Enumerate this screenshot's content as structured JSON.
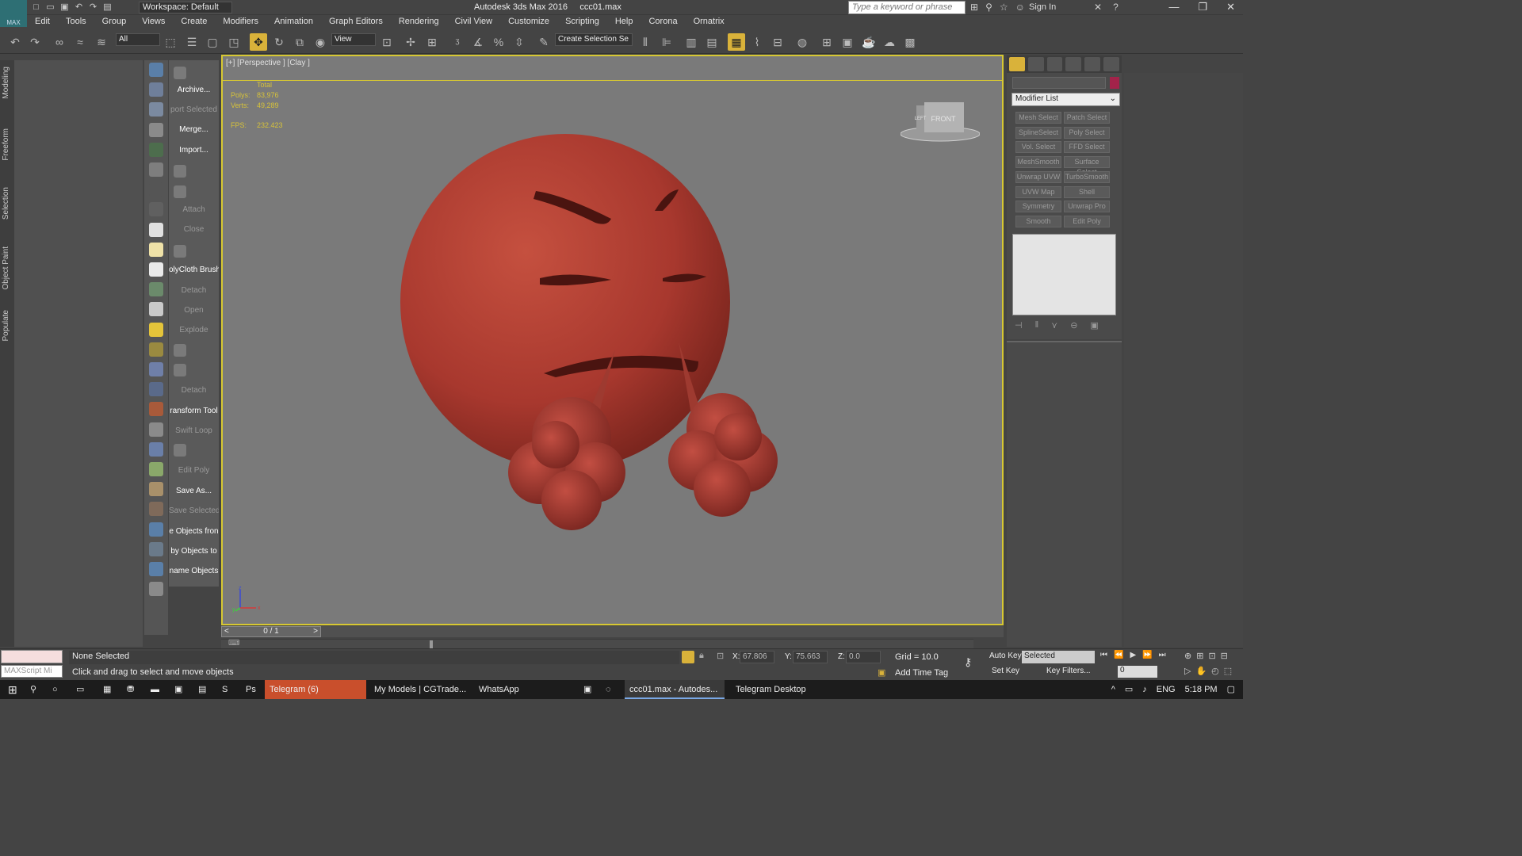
{
  "app": {
    "logo_text": "MAX",
    "title": "Autodesk 3ds Max 2016",
    "file": "ccc01.max",
    "workspace": "Workspace: Default",
    "search_placeholder": "Type a keyword or phrase",
    "sign_in": "Sign In"
  },
  "menu": [
    "Edit",
    "Tools",
    "Group",
    "Views",
    "Create",
    "Modifiers",
    "Animation",
    "Graph Editors",
    "Rendering",
    "Civil View",
    "Customize",
    "Scripting",
    "Help",
    "Corona",
    "Ornatrix"
  ],
  "toolbar": {
    "filter": "All",
    "refcoord": "View",
    "selection_set": "Create Selection Se"
  },
  "ribbon_tabs": [
    "Modeling",
    "Freeform",
    "Selection",
    "Object Paint",
    "Populate"
  ],
  "commands": [
    {
      "label": "Archive...",
      "enabled": true
    },
    {
      "label": "port Selected",
      "enabled": false
    },
    {
      "label": "Merge...",
      "enabled": true
    },
    {
      "label": "Import...",
      "enabled": true
    },
    {
      "label": "Attach",
      "enabled": false
    },
    {
      "label": "Close",
      "enabled": false
    },
    {
      "label": "olyCloth Brush",
      "enabled": true
    },
    {
      "label": "Detach",
      "enabled": false
    },
    {
      "label": "Open",
      "enabled": false
    },
    {
      "label": "Explode",
      "enabled": false
    },
    {
      "label": "Detach",
      "enabled": false
    },
    {
      "label": "ransform Tool",
      "enabled": true
    },
    {
      "label": "Swift Loop",
      "enabled": false
    },
    {
      "label": "Edit Poly",
      "enabled": false
    },
    {
      "label": "Save As...",
      "enabled": true
    },
    {
      "label": "Save Selected",
      "enabled": false
    },
    {
      "label": "e Objects fron",
      "enabled": true
    },
    {
      "label": "by Objects to",
      "enabled": true
    },
    {
      "label": "name Objects",
      "enabled": true
    }
  ],
  "viewport": {
    "label": "[+] [Perspective ] [Clay ]",
    "stats_header": "Total",
    "polys_label": "Polys:",
    "polys": "83,976",
    "verts_label": "Verts:",
    "verts": "49,289",
    "fps_label": "FPS:",
    "fps": "232.423",
    "cube_label": "FRONT",
    "cube_side": "LEFT",
    "axis_z": "z",
    "axis_y": "y",
    "axis_x": "x"
  },
  "timeline": {
    "frame": "0 / 1"
  },
  "command_panel": {
    "modifier_list": "Modifier List",
    "color": "#a3234a",
    "modifiers": [
      "Mesh Select",
      "Patch Select",
      "SplineSelect",
      "Poly Select",
      "Vol. Select",
      "FFD Select",
      "MeshSmooth",
      "Surface Select",
      "Unwrap UVW",
      "TurboSmooth",
      "UVW Map",
      "Shell",
      "Symmetry",
      "Unwrap Pro",
      "Smooth",
      "Edit Poly"
    ]
  },
  "status": {
    "maxscript": "MAXScript Mi",
    "selection": "None Selected",
    "prompt": "Click and drag to select and move objects",
    "x_label": "X:",
    "x": "67.806",
    "y_label": "Y:",
    "y": "75.663",
    "z_label": "Z:",
    "z": "0.0",
    "grid": "Grid = 10.0",
    "add_time_tag": "Add Time Tag",
    "auto_key": "Auto Key",
    "set_key": "Set Key",
    "key_mode": "Selected",
    "key_filters": "Key Filters...",
    "current_frame": "0"
  },
  "taskbar": {
    "apps": [
      "Telegram (6)",
      "My Models | CGTrade...",
      "WhatsApp",
      "ccc01.max - Autodes...",
      "Telegram Desktop"
    ],
    "lang": "ENG",
    "time": "5:18 PM"
  }
}
